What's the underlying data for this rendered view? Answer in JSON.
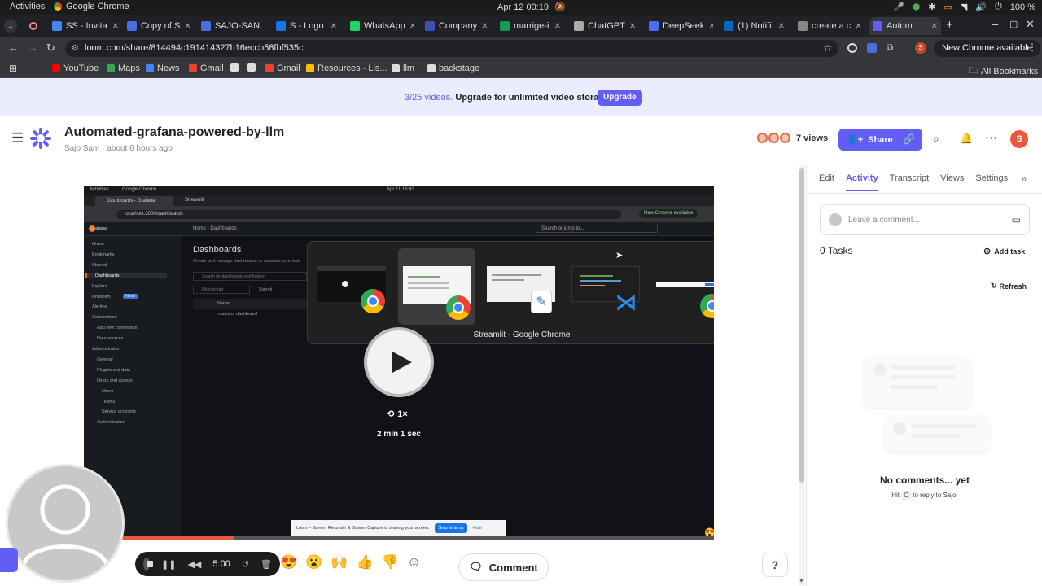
{
  "os": {
    "activities": "Activities",
    "app_name": "Google Chrome",
    "clock": "Apr 12  00:19",
    "battery": "100 %"
  },
  "tabs": [
    {
      "label": "SS - Invita",
      "color": "#4285f4"
    },
    {
      "label": "Copy of S",
      "color": "#4a6ee0"
    },
    {
      "label": "SAJO-SAN",
      "color": "#4a6ee0"
    },
    {
      "label": "S - Logo",
      "color": "#1a73e8"
    },
    {
      "label": "WhatsApp",
      "color": "#25d366"
    },
    {
      "label": "Company",
      "color": "#3f51b5"
    },
    {
      "label": "marrige-i",
      "color": "#0f9d58"
    },
    {
      "label": "ChatGPT",
      "color": "#aaaaaa"
    },
    {
      "label": "DeepSeek",
      "color": "#4d6bfe"
    },
    {
      "label": "(1) Notifi",
      "color": "#0a66c2"
    },
    {
      "label": "create a c",
      "color": "#888888"
    },
    {
      "label": "Autom",
      "color": "#625df5"
    }
  ],
  "address": {
    "url": "loom.com/share/814494c191414327b16eccb58fbf535c",
    "new_chrome": "New Chrome available",
    "profile_initial": "S"
  },
  "bookmarks": [
    {
      "label": "YouTube",
      "color": "#ff0000"
    },
    {
      "label": "Maps",
      "color": "#34a853"
    },
    {
      "label": "News",
      "color": "#4285f4"
    },
    {
      "label": "Gmail",
      "color": "#ea4335"
    },
    {
      "label": "",
      "color": "#dddddd"
    },
    {
      "label": "",
      "color": "#dddddd"
    },
    {
      "label": "Gmail",
      "color": "#ea4335"
    },
    {
      "label": "Resources - Lis...",
      "color": "#fbbc04"
    },
    {
      "label": "llm",
      "color": "#dddddd"
    },
    {
      "label": "backstage",
      "color": "#dddddd"
    }
  ],
  "all_bookmarks": "All Bookmarks",
  "banner": {
    "count": "3/25 videos.",
    "text": "Upgrade for unlimited video storage.",
    "button": "Upgrade"
  },
  "header": {
    "title": "Automated-grafana-powered-by-llm",
    "author": "Sajo Sam",
    "time": "about 6 hours ago",
    "views": "7 views",
    "share": "Share",
    "avatar_initial": "S"
  },
  "video": {
    "inner_tab1": "Dashboards - Grafana",
    "inner_tab2": "Streamlit",
    "inner_activities": "Activities",
    "inner_app": "Google Chrome",
    "inner_clock": "Apr 11  16:43",
    "inner_url": "localhost:3000/dashboards",
    "inner_new_chrome": "New Chrome available",
    "grafana_label": "Grafana",
    "breadcrumb_home": "Home",
    "breadcrumb_dash": "Dashboards",
    "search_jump": "Search or jump to...",
    "nav": [
      "Home",
      "Bookmarks",
      "Starred",
      "Dashboards",
      "Explore",
      "Drilldown",
      "Alerting",
      "Connections",
      "Add new connection",
      "Data sources",
      "Administration",
      "General",
      "Plugins and data",
      "Users and access",
      "Users",
      "Teams",
      "Service accounts",
      "Authentication"
    ],
    "new_badge": "New!",
    "page_title": "Dashboards",
    "page_sub": "Create and manage dashboards to visualize your data",
    "search_dash": "Search for dashboards and folders",
    "filter_tag": "Filter by tag",
    "starred": "Starred",
    "col_name": "Name",
    "row1": "cadvisor dashboard",
    "switcher_label": "Streamlit - Google Chrome",
    "speed": "1×",
    "duration": "2 min 1 sec",
    "share_msg": "Loom – Screen Recorder & Screen Capture is sharing your screen.",
    "stop_sharing": "Stop sharing",
    "hide": "Hide"
  },
  "controls": {
    "timer": "5:00",
    "comment": "Comment",
    "help": "?"
  },
  "panel": {
    "tabs": [
      "Edit",
      "Activity",
      "Transcript",
      "Views",
      "Settings"
    ],
    "comment_placeholder": "Leave a comment...",
    "tasks": "0 Tasks",
    "add_task": "Add task",
    "refresh": "Refresh",
    "empty_title": "No comments... yet",
    "hint_pre": "Hit",
    "hint_key": "C",
    "hint_post": "to reply to Sajo."
  }
}
